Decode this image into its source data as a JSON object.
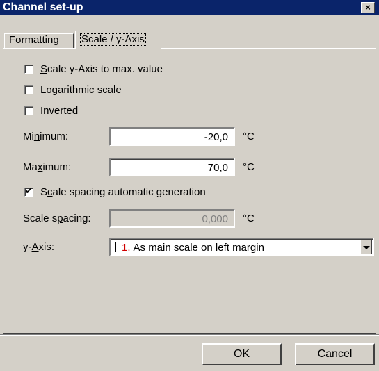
{
  "window": {
    "title": "Channel set-up",
    "close_glyph": "×"
  },
  "tabs": [
    {
      "label": "Formatting"
    },
    {
      "label": "Scale / y-Axis",
      "active": true
    }
  ],
  "checkboxes": {
    "scale_to_max": {
      "pre": "",
      "key": "S",
      "post": "cale y-Axis to max. value",
      "checked": false
    },
    "logarithmic": {
      "pre": "",
      "key": "L",
      "post": "ogarithmic scale",
      "checked": false
    },
    "inverted": {
      "pre": "In",
      "key": "v",
      "post": "erted",
      "checked": false
    },
    "auto_spacing": {
      "pre": "S",
      "key": "c",
      "post": "ale spacing automatic generation",
      "checked": true
    }
  },
  "fields": {
    "minimum": {
      "pre": "Mi",
      "key": "n",
      "post": "imum:",
      "value": "-20,0",
      "unit": "°C"
    },
    "maximum": {
      "pre": "Ma",
      "key": "x",
      "post": "imum:",
      "value": "70,0",
      "unit": "°C"
    },
    "scale_spacing": {
      "pre": "Scale s",
      "key": "p",
      "post": "acing:",
      "value": "0,000",
      "unit": "°C",
      "disabled": true
    }
  },
  "y_axis": {
    "pre": "y-",
    "key": "A",
    "post": "xis:",
    "selected_number": "1.",
    "selected_text": "As main scale on left margin"
  },
  "buttons": {
    "ok": "OK",
    "cancel": "Cancel"
  }
}
